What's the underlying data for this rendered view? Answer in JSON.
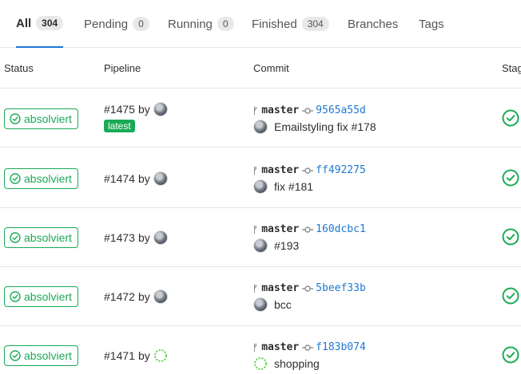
{
  "tabs": [
    {
      "label": "All",
      "count": "304"
    },
    {
      "label": "Pending",
      "count": "0"
    },
    {
      "label": "Running",
      "count": "0"
    },
    {
      "label": "Finished",
      "count": "304"
    },
    {
      "label": "Branches"
    },
    {
      "label": "Tags"
    }
  ],
  "columns": {
    "status": "Status",
    "pipeline": "Pipeline",
    "commit": "Commit",
    "stages": "Stag"
  },
  "pipelines": [
    {
      "status": "absolviert",
      "id": "#1475",
      "by": "by",
      "latest": "latest",
      "branch": "master",
      "sha": "9565a55d",
      "message": "Emailstyling fix #178",
      "avatar": "photo"
    },
    {
      "status": "absolviert",
      "id": "#1474",
      "by": "by",
      "branch": "master",
      "sha": "ff492275",
      "message": "fix #181",
      "avatar": "photo"
    },
    {
      "status": "absolviert",
      "id": "#1473",
      "by": "by",
      "branch": "master",
      "sha": "160dcbc1",
      "message": "#193",
      "avatar": "photo"
    },
    {
      "status": "absolviert",
      "id": "#1472",
      "by": "by",
      "branch": "master",
      "sha": "5beef33b",
      "message": "bcc",
      "avatar": "photo"
    },
    {
      "status": "absolviert",
      "id": "#1471",
      "by": "by",
      "branch": "master",
      "sha": "f183b074",
      "message": "shopping",
      "avatar": "identicon"
    }
  ],
  "colors": {
    "success": "#1aaa55",
    "link": "#1f78d1",
    "active_tab_underline": "#1f78d1"
  },
  "icons": {
    "status": "check-circle-icon",
    "branch": "branch-icon",
    "commit": "commit-icon",
    "stage": "stage-success-icon"
  }
}
